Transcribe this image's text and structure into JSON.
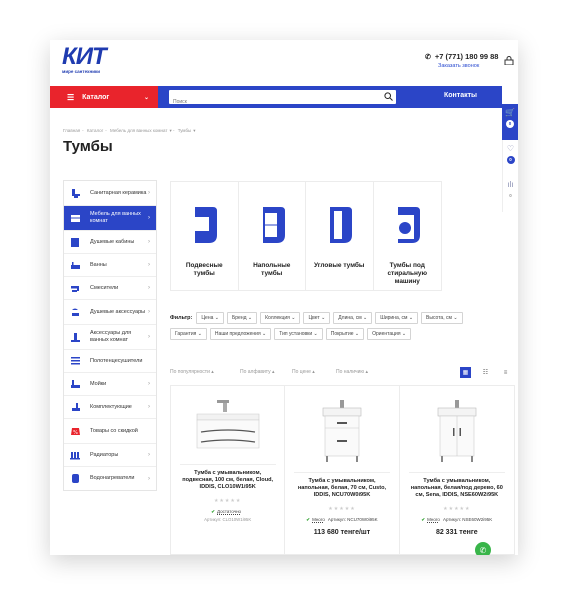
{
  "header": {
    "logo_text": "КИТ",
    "logo_sub": "мире сантехники",
    "phone": "+7 (771) 180 99 88",
    "callback": "Заказать звонок"
  },
  "nav": {
    "catalog": "Каталог",
    "search_placeholder": "Поиск",
    "contacts": "Контакты"
  },
  "side_panel": {
    "cart_count": "0",
    "fav_count": "0",
    "compare_count": "0"
  },
  "breadcrumb": [
    "Главная",
    "Каталог",
    "Мебель для ванных комнат",
    "Тумбы"
  ],
  "page_title": "Тумбы",
  "sidebar": {
    "items": [
      {
        "label": "Санитарная керамика",
        "icon": "toilet-icon"
      },
      {
        "label": "Мебель для ванных комнат",
        "icon": "cabinet-icon"
      },
      {
        "label": "Душевые кабины",
        "icon": "shower-cabin-icon"
      },
      {
        "label": "Ванны",
        "icon": "bathtub-icon"
      },
      {
        "label": "Смесители",
        "icon": "faucet-icon"
      },
      {
        "label": "Душевые аксессуары",
        "icon": "shower-head-icon"
      },
      {
        "label": "Аксессуары для ванных комнат",
        "icon": "accessory-icon"
      },
      {
        "label": "Полотенцесушители",
        "icon": "towel-rail-icon"
      },
      {
        "label": "Мойки",
        "icon": "sink-icon"
      },
      {
        "label": "Комплектующие",
        "icon": "parts-icon"
      },
      {
        "label": "Товары со скидкой",
        "icon": "discount-icon"
      },
      {
        "label": "Радиаторы",
        "icon": "radiator-icon"
      },
      {
        "label": "Водонагреватели",
        "icon": "water-heater-icon"
      }
    ]
  },
  "categories": [
    {
      "label": "Подвесные тумбы"
    },
    {
      "label": "Напольные тумбы"
    },
    {
      "label": "Угловые тумбы"
    },
    {
      "label": "Тумбы под стиральную машину"
    }
  ],
  "filters": {
    "title": "Фильтр:",
    "row1": [
      "Цена",
      "Бренд",
      "Коллекция",
      "Цвет",
      "Длина, см",
      "Ширина, см",
      "Высота, см"
    ],
    "row2": [
      "Гарантия",
      "Наши предложения",
      "Тип установки",
      "Покрытие",
      "Ориентация"
    ]
  },
  "sort": {
    "by_popularity": "По популярности",
    "by_alphabet": "По алфавиту",
    "by_price": "По цене",
    "by_stock": "По наличию"
  },
  "products": [
    {
      "name": "Тумба с умывальником, подвесная, 100 см, белая, Cloud, IDDIS, CLO10W1i95K",
      "stock": "Достаточно",
      "article": "Артикул: CLO10W1i95K",
      "price": ""
    },
    {
      "name": "Тумба с умывальником, напольная, белая, 70 см, Custo, IDDIS, NCU70W0i95K",
      "stock": "Много",
      "article": "Артикул: NCU70W0i95K",
      "price": "113 680 тенге/шт"
    },
    {
      "name": "Тумба с умывальником, напольная, белая/под дерево, 60 см, Sena, IDDIS, NSE60W2i95K",
      "stock": "Много",
      "article": "Артикул: NSE60W2i95K",
      "price": "82 331 тенге"
    }
  ],
  "colors": {
    "brand_blue": "#2b45c7",
    "catalog_red": "#e9242c",
    "stock_green": "#2ca02c"
  }
}
